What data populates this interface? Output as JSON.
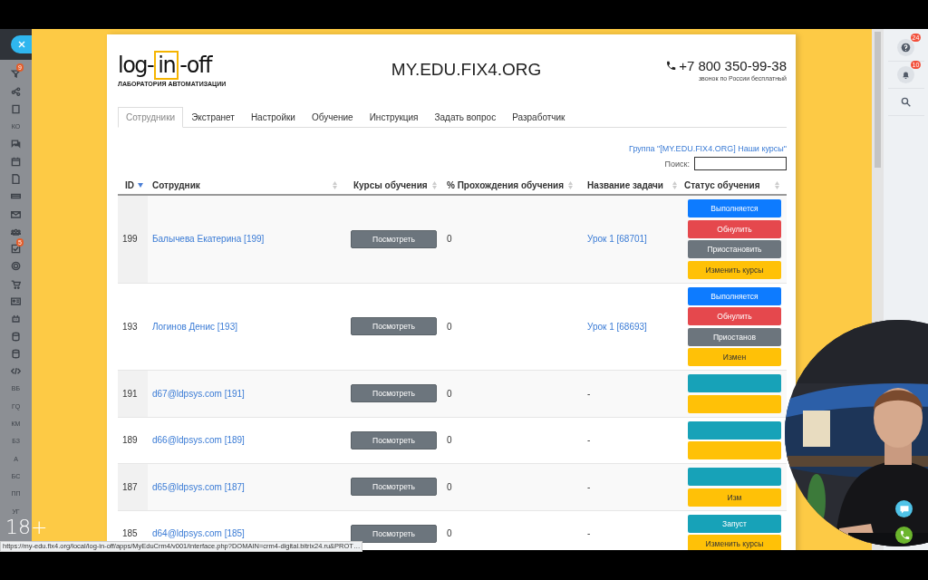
{
  "sidebar": {
    "items": [
      {
        "kind": "icon",
        "badge": "9"
      },
      {
        "kind": "icon"
      },
      {
        "kind": "icon"
      },
      {
        "kind": "text",
        "label": "КО"
      },
      {
        "kind": "icon"
      },
      {
        "kind": "icon"
      },
      {
        "kind": "icon"
      },
      {
        "kind": "icon"
      },
      {
        "kind": "icon"
      },
      {
        "kind": "icon"
      },
      {
        "kind": "icon",
        "badge": "5"
      },
      {
        "kind": "icon"
      },
      {
        "kind": "icon"
      },
      {
        "kind": "icon"
      },
      {
        "kind": "icon"
      },
      {
        "kind": "icon"
      },
      {
        "kind": "icon"
      },
      {
        "kind": "icon"
      },
      {
        "kind": "text",
        "label": "ВБ"
      },
      {
        "kind": "text",
        "label": "ГQ"
      },
      {
        "kind": "text",
        "label": "КМ"
      },
      {
        "kind": "text",
        "label": "БЗ"
      },
      {
        "kind": "text",
        "label": "А"
      },
      {
        "kind": "text",
        "label": "БС"
      },
      {
        "kind": "text",
        "label": "ПП"
      },
      {
        "kind": "text",
        "label": "УГ"
      }
    ]
  },
  "logo": {
    "wordmark": [
      {
        "text": "log-",
        "boxed": false
      },
      {
        "text": "in",
        "boxed": true
      },
      {
        "text": "-off",
        "boxed": false
      }
    ],
    "subtitle": "ЛАБОРАТОРИЯ АВТОМАТИЗАЦИИ"
  },
  "site_title": "MY.EDU.FIX4.ORG",
  "phone": {
    "number": "+7 800 350-99-38",
    "note": "звонок по России бесплатный"
  },
  "tabs": [
    {
      "label": "Сотрудники",
      "selected": true
    },
    {
      "label": "Экстранет",
      "selected": false
    },
    {
      "label": "Настройки",
      "selected": false
    },
    {
      "label": "Обучение",
      "selected": false
    },
    {
      "label": "Инструкция",
      "selected": false
    },
    {
      "label": "Задать вопрос",
      "selected": false
    },
    {
      "label": "Разработчик",
      "selected": false
    }
  ],
  "group_link": "Группа \"[MY.EDU.FIX4.ORG] Наши курсы\"",
  "search": {
    "label": "Поиск:"
  },
  "table": {
    "columns": [
      {
        "label": "ID",
        "sorted": true
      },
      {
        "label": "Сотрудник",
        "sorted": false
      },
      {
        "label": "Курсы обучения",
        "sorted": false
      },
      {
        "label": "% Прохождения обучения",
        "sorted": false
      },
      {
        "label": "Название задачи",
        "sorted": false
      },
      {
        "label": "Статус обучения",
        "sorted": false
      }
    ],
    "rows": [
      {
        "id": "199",
        "name": "Балычева Екатерина [199]",
        "courses": "Посмотреть",
        "progress": "0",
        "task": "Урок 1 [68701]",
        "task_link": true,
        "actions": [
          {
            "kind": "running",
            "label": "Выполняется"
          },
          {
            "kind": "reset",
            "label": "Обнулить"
          },
          {
            "kind": "pause",
            "label": "Приостановить"
          },
          {
            "kind": "change",
            "label": "Изменить курсы"
          }
        ]
      },
      {
        "id": "193",
        "name": "Логинов Денис [193]",
        "courses": "Посмотреть",
        "progress": "0",
        "task": "Урок 1 [68693]",
        "task_link": true,
        "actions": [
          {
            "kind": "running",
            "label": "Выполняется"
          },
          {
            "kind": "reset",
            "label": "Обнулить"
          },
          {
            "kind": "pause",
            "label": "Приостанов"
          },
          {
            "kind": "change",
            "label": "Измен"
          }
        ]
      },
      {
        "id": "191",
        "name": "d67@ldpsys.com [191]",
        "courses": "Посмотреть",
        "progress": "0",
        "task": "-",
        "task_link": false,
        "actions": [
          {
            "kind": "start"
          },
          {
            "kind": "change"
          }
        ]
      },
      {
        "id": "189",
        "name": "d66@ldpsys.com [189]",
        "courses": "Посмотреть",
        "progress": "0",
        "task": "-",
        "task_link": false,
        "actions": [
          {
            "kind": "start"
          },
          {
            "kind": "change"
          }
        ]
      },
      {
        "id": "187",
        "name": "d65@ldpsys.com [187]",
        "courses": "Посмотреть",
        "progress": "0",
        "task": "-",
        "task_link": false,
        "actions": [
          {
            "kind": "start"
          },
          {
            "kind": "change",
            "label": "Изм"
          }
        ]
      },
      {
        "id": "185",
        "name": "d64@ldpsys.com [185]",
        "courses": "Посмотреть",
        "progress": "0",
        "task": "-",
        "task_link": false,
        "actions": [
          {
            "kind": "start",
            "label": "Запуст"
          },
          {
            "kind": "change",
            "label": "Изменить курсы"
          }
        ]
      }
    ]
  },
  "right_panel": {
    "help_badge": "24",
    "notifications_badge": "10"
  },
  "age_rating": "18+",
  "status_url": "https://my-edu.fix4.org/local/log-in-off/apps/MyEduCrm4/v001/interface.php?DOMAIN=crm4-digital.bitrix24.ru&PROT…"
}
